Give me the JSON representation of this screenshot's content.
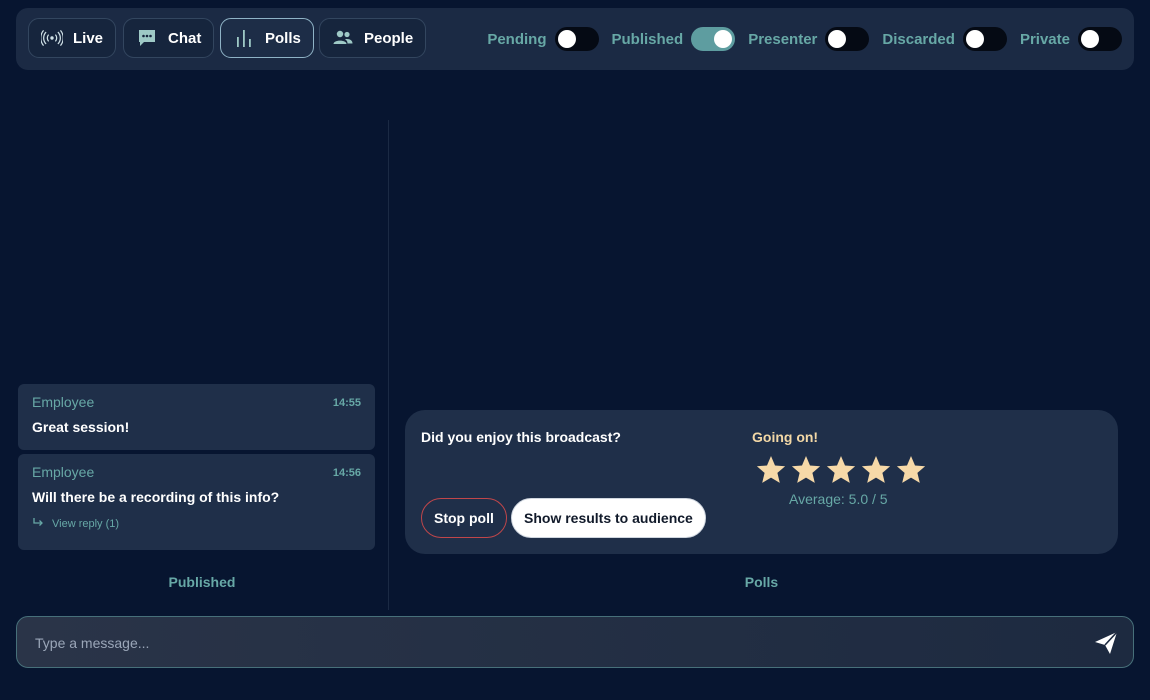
{
  "tabs": [
    {
      "label": "Live",
      "icon": "broadcast-icon",
      "active": false
    },
    {
      "label": "Chat",
      "icon": "chat-bubble-icon",
      "active": false
    },
    {
      "label": "Polls",
      "icon": "bar-chart-icon",
      "active": true
    },
    {
      "label": "People",
      "icon": "people-icon",
      "active": false
    }
  ],
  "filters": [
    {
      "label": "Pending",
      "on": false
    },
    {
      "label": "Published",
      "on": true
    },
    {
      "label": "Presenter",
      "on": false
    },
    {
      "label": "Discarded",
      "on": false
    },
    {
      "label": "Private",
      "on": false
    }
  ],
  "messages": [
    {
      "author": "Employee",
      "time": "14:55",
      "text": "Great session!"
    },
    {
      "author": "Employee",
      "time": "14:56",
      "text": "Will there be a recording of this info?",
      "reply": "View reply (1)"
    }
  ],
  "columns": {
    "left": "Published",
    "right": "Polls"
  },
  "poll": {
    "question": "Did you enjoy this broadcast?",
    "status": "Going on!",
    "rating": 5,
    "max_rating": 5,
    "average": "Average: 5.0 / 5",
    "stop_label": "Stop poll",
    "show_label": "Show results to audience"
  },
  "composer": {
    "placeholder": "Type a message..."
  },
  "colors": {
    "background": "#071530",
    "panel": "#1f2f49",
    "accent": "#67a8a6",
    "star": "#f6d9a8",
    "status": "#f3d8a6"
  }
}
